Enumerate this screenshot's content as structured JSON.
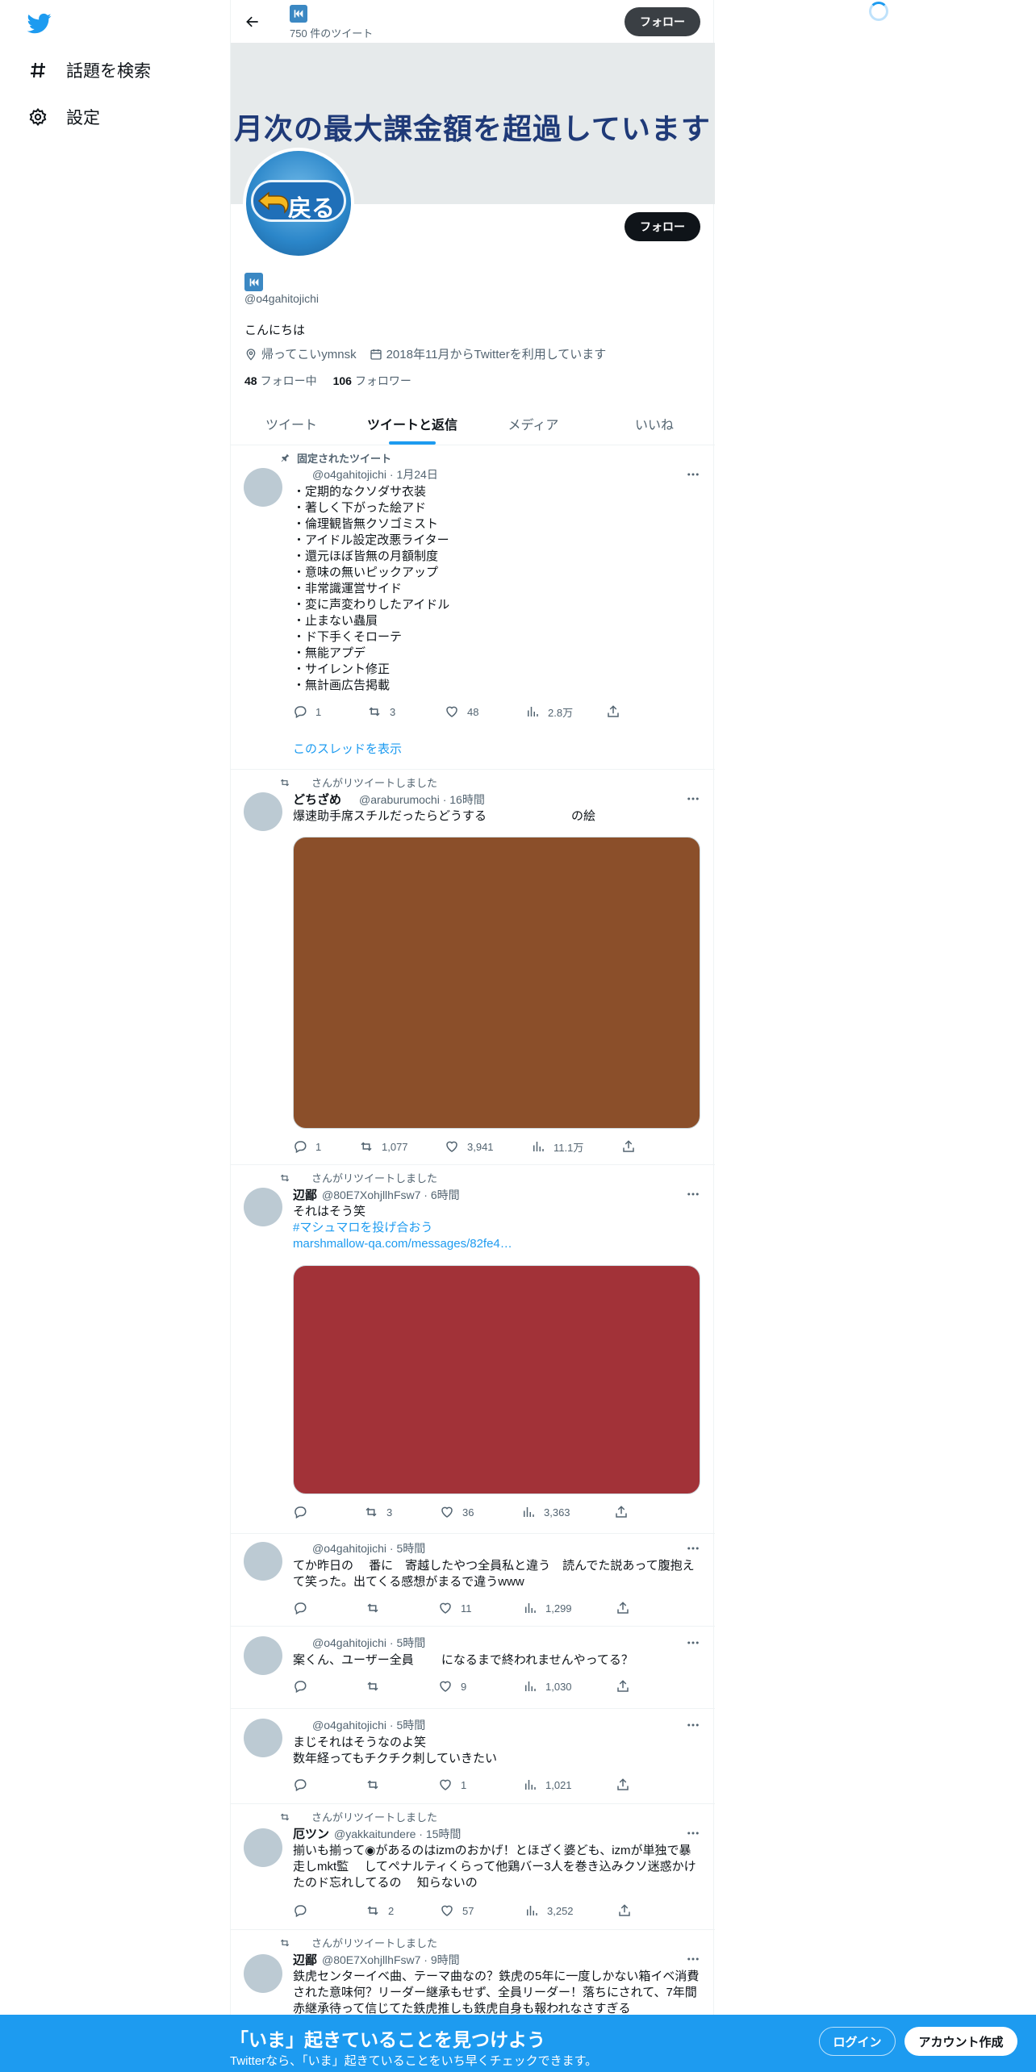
{
  "colors": {
    "accent": "#1d9bf0",
    "text": "#0f1419",
    "muted": "#536471",
    "bottom_bar": "#1d9bf0"
  },
  "nav": {
    "logo_icon": "twitter-bird-icon",
    "items": [
      {
        "label": "話題を検索",
        "icon": "hashtag-icon"
      },
      {
        "label": "設定",
        "icon": "gear-icon"
      }
    ]
  },
  "header": {
    "tweet_count": "750 件のツイート",
    "follow_label": "フォロー"
  },
  "banner": {
    "text": "月次の最大課金額を超過しています"
  },
  "avatar": {
    "button_text": "戻る"
  },
  "profile": {
    "follow_label": "フォロー",
    "handle": "@o4gahitojichi",
    "bio": "こんにちは",
    "location": "帰ってこいymnsk",
    "joined": "2018年11月からTwitterを利用しています",
    "following_count": "48",
    "following_label": "フォロー中",
    "followers_count": "106",
    "followers_label": "フォロワー"
  },
  "tabs": [
    {
      "label": "ツイート",
      "active": false
    },
    {
      "label": "ツイートと返信",
      "active": true
    },
    {
      "label": "メディア",
      "active": false
    },
    {
      "label": "いいね",
      "active": false
    }
  ],
  "tweets": [
    {
      "social": "固定されたツイート",
      "handle": "@o4gahitojichi · 1月24日",
      "text": "・定期的なクソダサ衣装\n・著しく下がった絵アド\n・倫理観皆無クソゴミスト\n・アイドル設定改悪ライター\n・還元ほぼ皆無の月額制度\n・意味の無いピックアップ\n・非常識運営サイド\n・変に声変わりしたアイドル\n・止まない蟲屓\n・ド下手くそローテ\n・無能アプデ\n・サイレント修正\n・無計画広告掲載",
      "reply": "1",
      "retweet": "3",
      "like": "48",
      "views": "2.8万",
      "show_thread": "このスレッドを表示"
    },
    {
      "social": "さんがリツイートしました",
      "name": "どちざめ",
      "handle": "@araburumochi · 16時間",
      "text": "爆速助手席スチルだったらどうする　　　　　　　の絵",
      "media_color": "#8b4f2a",
      "reply": "1",
      "retweet": "1,077",
      "like": "3,941",
      "views": "11.1万"
    },
    {
      "social": "さんがリツイートしました",
      "name": "辺鄙",
      "handle": "@80E7XohjllhFsw7 · 6時間",
      "text": "それはそう笑",
      "hashtag": "#マシュマロを投げ合おう",
      "link": "marshmallow-qa.com/messages/82fe4…",
      "media_color": "#a23238",
      "reply": "",
      "retweet": "3",
      "like": "36",
      "views": "3,363"
    },
    {
      "handle": "@o4gahitojichi · 5時間",
      "text": "てか昨日の　 番に　寄越したやつ全員私と違う　読んでた説あって腹抱えて笑った。出てくる感想がまるで違うwww",
      "reply": "",
      "retweet": "",
      "like": "11",
      "views": "1,299"
    },
    {
      "handle": "@o4gahitojichi · 5時間",
      "text": "案くん、ユーザー全員　　 になるまで終われませんやってる？",
      "reply": "",
      "retweet": "",
      "like": "9",
      "views": "1,030"
    },
    {
      "handle": "@o4gahitojichi · 5時間",
      "text": "まじそれはそうなのよ笑\n数年経ってもチクチク刺していきたい",
      "reply": "",
      "retweet": "",
      "like": "1",
      "views": "1,021"
    },
    {
      "social": "さんがリツイートしました",
      "name": "厄ツン",
      "handle": "@yakkaitundere · 15時間",
      "text": "揃いも揃って◉があるのはizmのおかげ！とほざく婆ども、izmが単独で暴走しmkt監　 してペナルティくらって他鶏バー3人を巻き込みクソ迷惑かけたのド忘れしてるの　 知らないの",
      "reply": "",
      "retweet": "2",
      "like": "57",
      "views": "3,252"
    },
    {
      "social": "さんがリツイートしました",
      "name": "辺鄙",
      "handle": "@80E7XohjllhFsw7 · 9時間",
      "text": "鉄虎センターイベ曲、テーマ曲なの？鉄虎の5年に一度しかない箱イベ消費された意味何？リーダー継承もせず、全員リーダー！落ちにされて、7年間赤継承待って信じてた鉄虎推しも鉄虎自身も報われなさすぎる"
    }
  ],
  "bottom_bar": {
    "title": "「いま」起きていることを見つけよう",
    "subtitle": "Twitterなら、「いま」起きていることをいち早くチェックできます。",
    "login": "ログイン",
    "signup": "アカウント作成"
  }
}
